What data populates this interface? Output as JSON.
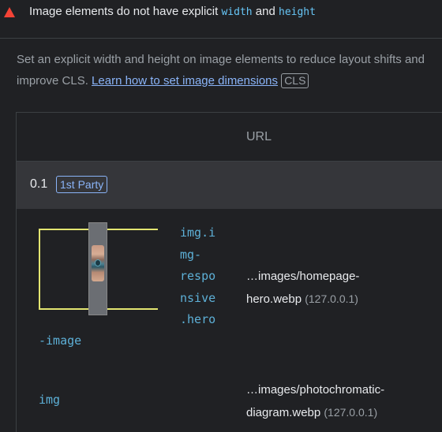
{
  "audit": {
    "title_prefix": "Image elements do not have explicit",
    "code_width": "width",
    "and": "and",
    "code_height": "height",
    "description": "Set an explicit width and height on image elements to reduce layout shifts and improve CLS.",
    "learn_link": "Learn how to set image dimensions",
    "cls_badge": "CLS"
  },
  "table": {
    "header_url": "URL",
    "group": {
      "score": "0.1",
      "party_badge": "1st Party"
    },
    "rows": [
      {
        "selector_lines": [
          "img.i",
          "mg-",
          "respo",
          "nsive",
          ".hero"
        ],
        "selector_tail": "-image",
        "url": "…images/homepage-",
        "url_line2": "hero.webp",
        "origin": "(127.0.0.1)"
      },
      {
        "selector": "img",
        "url": "…images/photochromatic-",
        "url_line2": "diagram.webp",
        "origin": "(127.0.0.1)"
      }
    ]
  },
  "colors": {
    "background": "#202124",
    "group_row": "#35363a",
    "warning": "#f44336",
    "link": "#8ab4f8",
    "code": "#5db0d7",
    "highlight_box": "#e3e571"
  },
  "icons": {
    "warning": "warning-triangle-icon"
  }
}
